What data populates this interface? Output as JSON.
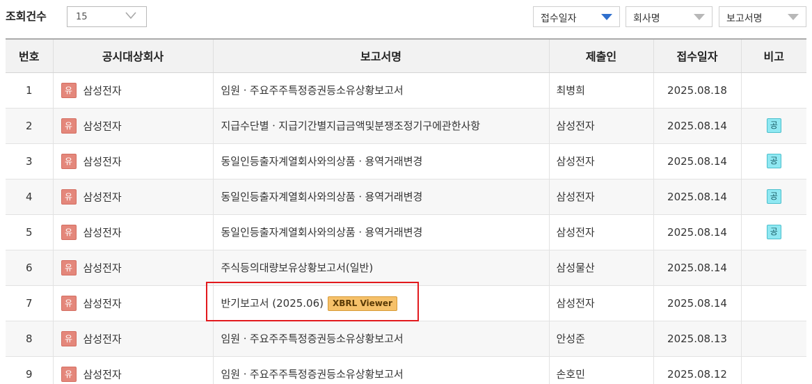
{
  "toolbar": {
    "count_label": "조회건수",
    "page_size": "15",
    "sort_options": [
      {
        "label": "접수일자",
        "active": true
      },
      {
        "label": "회사명",
        "active": false
      },
      {
        "label": "보고서명",
        "active": false
      }
    ]
  },
  "table": {
    "headers": [
      "번호",
      "공시대상회사",
      "보고서명",
      "제출인",
      "접수일자",
      "비고"
    ],
    "rows": [
      {
        "no": "1",
        "badge": "유",
        "company": "삼성전자",
        "report": "임원ㆍ주요주주특정증권등소유상황보고서",
        "report_extra": "",
        "filer": "최병희",
        "date": "2025.08.18",
        "note": ""
      },
      {
        "no": "2",
        "badge": "유",
        "company": "삼성전자",
        "report": "지급수단별ㆍ지급기간별지급금액및분쟁조정기구에관한사항",
        "report_extra": "",
        "filer": "삼성전자",
        "date": "2025.08.14",
        "note": "공"
      },
      {
        "no": "3",
        "badge": "유",
        "company": "삼성전자",
        "report": "동일인등출자계열회사와의상품ㆍ용역거래변경",
        "report_extra": "",
        "filer": "삼성전자",
        "date": "2025.08.14",
        "note": "공"
      },
      {
        "no": "4",
        "badge": "유",
        "company": "삼성전자",
        "report": "동일인등출자계열회사와의상품ㆍ용역거래변경",
        "report_extra": "",
        "filer": "삼성전자",
        "date": "2025.08.14",
        "note": "공"
      },
      {
        "no": "5",
        "badge": "유",
        "company": "삼성전자",
        "report": "동일인등출자계열회사와의상품ㆍ용역거래변경",
        "report_extra": "",
        "filer": "삼성전자",
        "date": "2025.08.14",
        "note": "공"
      },
      {
        "no": "6",
        "badge": "유",
        "company": "삼성전자",
        "report": "주식등의대량보유상황보고서(일반)",
        "report_extra": "",
        "filer": "삼성물산",
        "date": "2025.08.14",
        "note": ""
      },
      {
        "no": "7",
        "badge": "유",
        "company": "삼성전자",
        "report": "반기보고서 (2025.06)",
        "report_extra": "XBRL Viewer",
        "filer": "삼성전자",
        "date": "2025.08.14",
        "note": ""
      },
      {
        "no": "8",
        "badge": "유",
        "company": "삼성전자",
        "report": "임원ㆍ주요주주특정증권등소유상황보고서",
        "report_extra": "",
        "filer": "안성준",
        "date": "2025.08.13",
        "note": ""
      },
      {
        "no": "9",
        "badge": "유",
        "company": "삼성전자",
        "report": "임원ㆍ주요주주특정증권등소유상황보고서",
        "report_extra": "",
        "filer": "손호민",
        "date": "2025.08.12",
        "note": ""
      }
    ]
  },
  "colors": {
    "sort_active": "#2f6fcd",
    "badge_yu": "#e4877b",
    "badge_gong": "#8fe8f2",
    "xbrl_badge": "#f6c16a",
    "highlight": "#e2191d"
  }
}
